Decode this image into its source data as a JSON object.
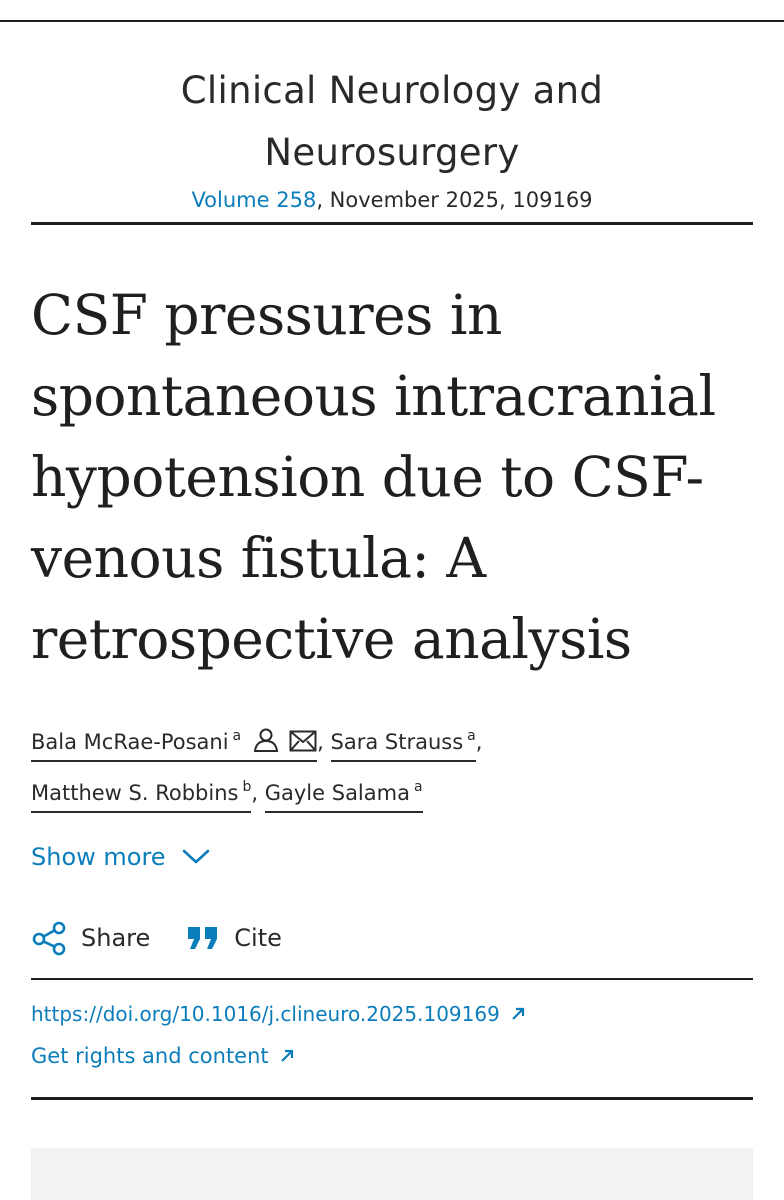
{
  "journal": {
    "title_line1": "Clinical Neurology and",
    "title_line2": "Neurosurgery",
    "volume_link": "Volume 258",
    "issue_info": ", November 2025, 109169"
  },
  "article": {
    "title": "CSF pressures in spontaneous intracranial hypotension due to CSF-venous fistula: A retrospective analysis"
  },
  "authors": [
    {
      "name": "Bala McRae-Posani",
      "affiliation": "a",
      "icons": [
        "person-icon",
        "mail-icon"
      ]
    },
    {
      "name": "Sara Strauss",
      "affiliation": "a"
    },
    {
      "name": "Matthew S. Robbins",
      "affiliation": "b"
    },
    {
      "name": "Gayle Salama",
      "affiliation": "a"
    }
  ],
  "separators": {
    "comma": ","
  },
  "show_more": {
    "label": "Show more",
    "icon": "chevron-down-icon"
  },
  "actions": {
    "share_label": "Share",
    "share_icon": "share-icon",
    "cite_label": "Cite",
    "cite_icon": "quote-icon"
  },
  "links": {
    "doi": "https://doi.org/10.1016/j.clineuro.2025.109169",
    "rights": "Get rights and content",
    "external_icon": "external-link-icon"
  },
  "colors": {
    "link": "#0c7dbb",
    "text": "#1f1f1f",
    "panel": "#f2f2f2"
  }
}
